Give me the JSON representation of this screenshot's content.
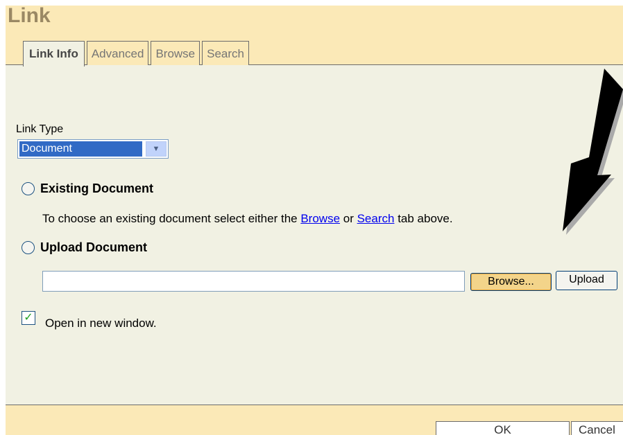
{
  "dialog": {
    "title": "Link"
  },
  "tabs": [
    {
      "label": "Link Info",
      "active": true
    },
    {
      "label": "Advanced",
      "active": false
    },
    {
      "label": "Browse",
      "active": false
    },
    {
      "label": "Search",
      "active": false
    }
  ],
  "link_type": {
    "label": "Link Type",
    "selected": "Document"
  },
  "existing": {
    "label": "Existing Document",
    "desc_before": "To choose an existing document select either the ",
    "browse_link": "Browse",
    "desc_or": " or ",
    "search_link": "Search",
    "desc_after": " tab above."
  },
  "upload": {
    "label": "Upload Document",
    "file_value": "",
    "browse_button": "Browse...",
    "upload_button": "Upload"
  },
  "new_window": {
    "label": "Open in new window.",
    "checked": true,
    "check_mark": "✓"
  },
  "footer": {
    "ok_label": "OK",
    "cancel_label": "Cancel"
  },
  "colors": {
    "header_bg": "#fbe9b7",
    "body_bg": "#f1f1e3",
    "title": "#9a8864",
    "selection": "#316ac5",
    "link": "#0000ee",
    "check": "#21a121"
  },
  "icons": {
    "dropdown": "chevron-down-icon",
    "annotation": "arrow-icon",
    "dropdown_glyph": "▼"
  }
}
